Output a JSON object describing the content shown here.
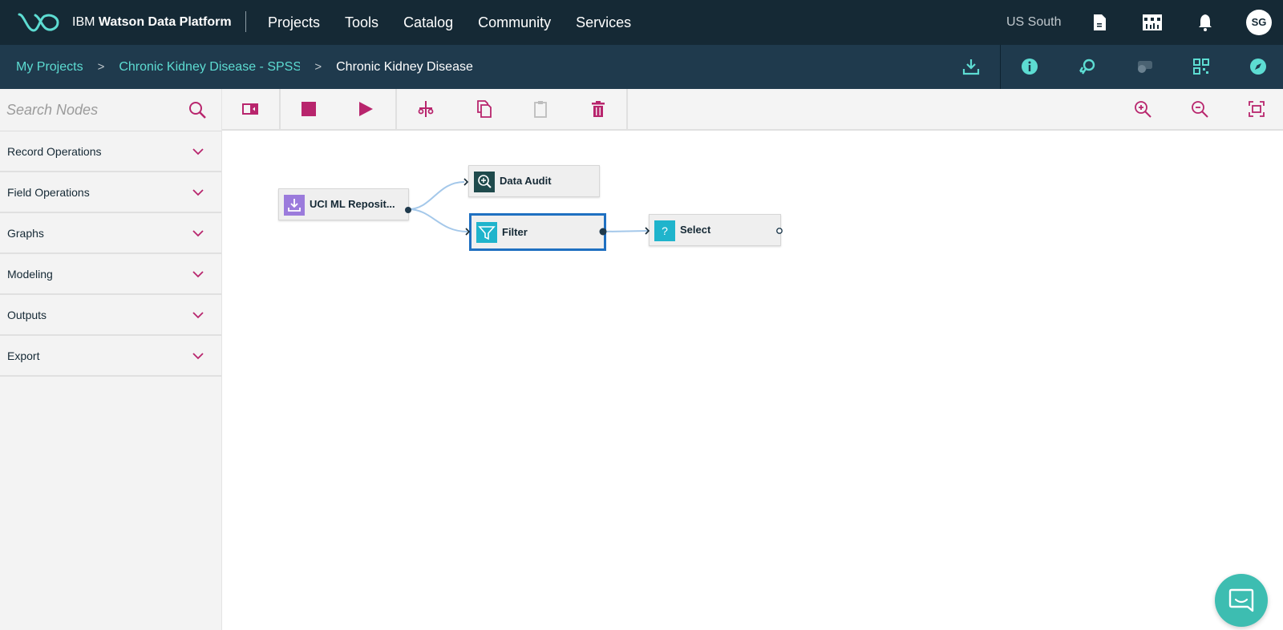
{
  "topbar": {
    "brand_prefix": "IBM",
    "brand_name": "Watson Data Platform",
    "nav": [
      "Projects",
      "Tools",
      "Catalog",
      "Community",
      "Services"
    ],
    "region": "US South",
    "avatar_initials": "SG"
  },
  "breadcrumb": {
    "items": [
      "My Projects",
      "Chronic Kidney Disease - SPSS Modeler",
      "Chronic Kidney Disease"
    ],
    "separator": ">"
  },
  "sidebar": {
    "search_placeholder": "Search Nodes",
    "categories": [
      "Record Operations",
      "Field Operations",
      "Graphs",
      "Modeling",
      "Outputs",
      "Export"
    ]
  },
  "canvas": {
    "nodes": [
      {
        "label": "UCI ML Reposit...",
        "icon": "import-icon",
        "icon_color": "#9b7bdc"
      },
      {
        "label": "Data Audit",
        "icon": "magnify-plus-icon",
        "icon_color": "#1f4a4c"
      },
      {
        "label": "Filter",
        "icon": "filter-icon",
        "icon_color": "#1fb4cc"
      },
      {
        "label": "Select",
        "icon": "question-icon",
        "icon_color": "#1fb4cc"
      }
    ],
    "connections": [
      [
        "UCI ML Reposit...",
        "Data Audit"
      ],
      [
        "UCI ML Reposit...",
        "Filter"
      ],
      [
        "Filter",
        "Select"
      ]
    ]
  },
  "colors": {
    "topbar": "#152935",
    "crumbbar": "#1f3a4d",
    "accent_teal": "#5ddcd2",
    "accent_magenta": "#b8256d",
    "selection": "#1f70c1"
  }
}
